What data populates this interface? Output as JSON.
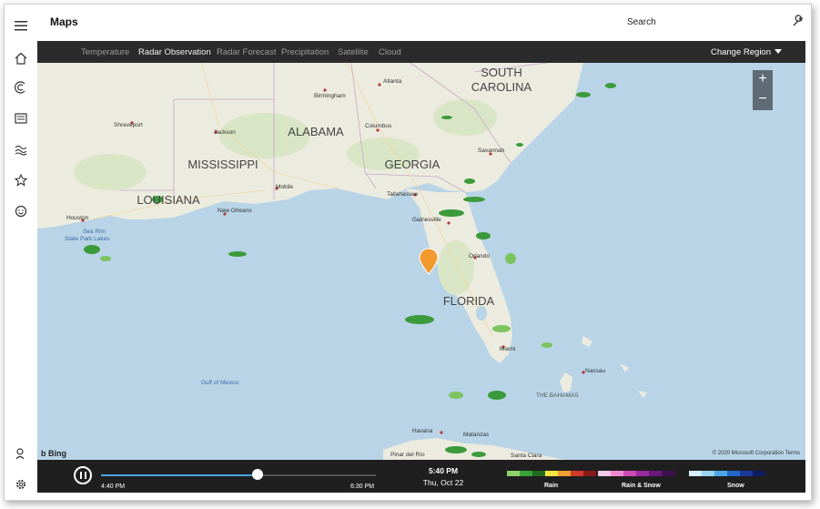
{
  "app": {
    "title": "Maps",
    "search_label": "Search"
  },
  "rail": {
    "top_icons": [
      "menu-icon",
      "home-icon",
      "weather-icon",
      "news-icon",
      "maps-icon",
      "favorites-icon",
      "life-icon"
    ],
    "bottom_icons": [
      "account-icon",
      "settings-icon"
    ]
  },
  "tabs": [
    {
      "label": "Temperature",
      "active": false
    },
    {
      "label": "Radar Observation",
      "active": true
    },
    {
      "label": "Radar Forecast",
      "active": false
    },
    {
      "label": "Precipitation",
      "active": false
    },
    {
      "label": "Satellite",
      "active": false
    },
    {
      "label": "Cloud",
      "active": false
    }
  ],
  "change_region": "Change Region",
  "map": {
    "states": [
      "SOUTH CAROLINA",
      "ALABAMA",
      "MISSISSIPPI",
      "GEORGIA",
      "LOUISIANA",
      "FLORIDA"
    ],
    "state_line2": "SOUTH",
    "state_line2b": "CAROLINA",
    "cities": [
      "Birmingham",
      "Atlanta",
      "Shreveport",
      "Jackson",
      "Columbus",
      "Savannah",
      "Mobile",
      "Tallahassee",
      "New Orleans",
      "Gainesville",
      "Houston",
      "Sea Rim State Park Lakes",
      "Orlando",
      "Miami",
      "Nassau",
      "THE BAHAMAS",
      "Havana",
      "Matanzas",
      "Gulf of Mexico",
      "Santa Clara"
    ],
    "labels": {
      "birmingham": "Birmingham",
      "atlanta": "Atlanta",
      "shreveport": "Shreveport",
      "jackson": "Jackson",
      "columbus": "Columbus",
      "savannah": "Savannah",
      "mobile": "Mobile",
      "tallahassee": "Tallahassee",
      "new_orleans": "New Orleans",
      "gainesville": "Gainesville",
      "houston": "Houston",
      "sea_rim_1": "Sea Rim",
      "sea_rim_2": "State Park Lakes",
      "orlando": "Orlando",
      "miami": "Miami",
      "nassau": "Nassau",
      "bahamas": "THE BAHAMAS",
      "havana": "Havana",
      "matanzas": "Matanzas",
      "gulf": "Gulf of Mexico",
      "santa_clara": "Santa Clara",
      "pinar": "Pinar del Río",
      "alabama": "ALABAMA",
      "mississippi": "MISSISSIPPI",
      "georgia": "GEORGIA",
      "louisiana": "LOUISIANA",
      "florida": "FLORIDA",
      "sc1": "SOUTH",
      "sc2": "CAROLINA"
    },
    "zoom_in": "+",
    "zoom_out": "−",
    "bing_label": "Bing",
    "copyright": "© 2020 Microsoft Corporation  Terms"
  },
  "timeline": {
    "start_time": "4:40 PM",
    "end_time": "6:30 PM",
    "current_time": "5:40 PM",
    "current_date": "Thu, Oct 22",
    "progress": 0.57,
    "legend": [
      {
        "label": "Rain",
        "colors": [
          "#8fd16a",
          "#37a33a",
          "#1f6a1f",
          "#f4e542",
          "#f0a030",
          "#d23a2a",
          "#8a1a1a"
        ]
      },
      {
        "label": "Rain & Snow",
        "colors": [
          "#f7c8e8",
          "#f08ad0",
          "#d04ab8",
          "#9a2aa0",
          "#6a1a78",
          "#401050"
        ]
      },
      {
        "label": "Snow",
        "colors": [
          "#d8f0ff",
          "#9ad4f4",
          "#4aa8e8",
          "#2468c8",
          "#1a3a9a",
          "#101c60"
        ]
      }
    ]
  }
}
